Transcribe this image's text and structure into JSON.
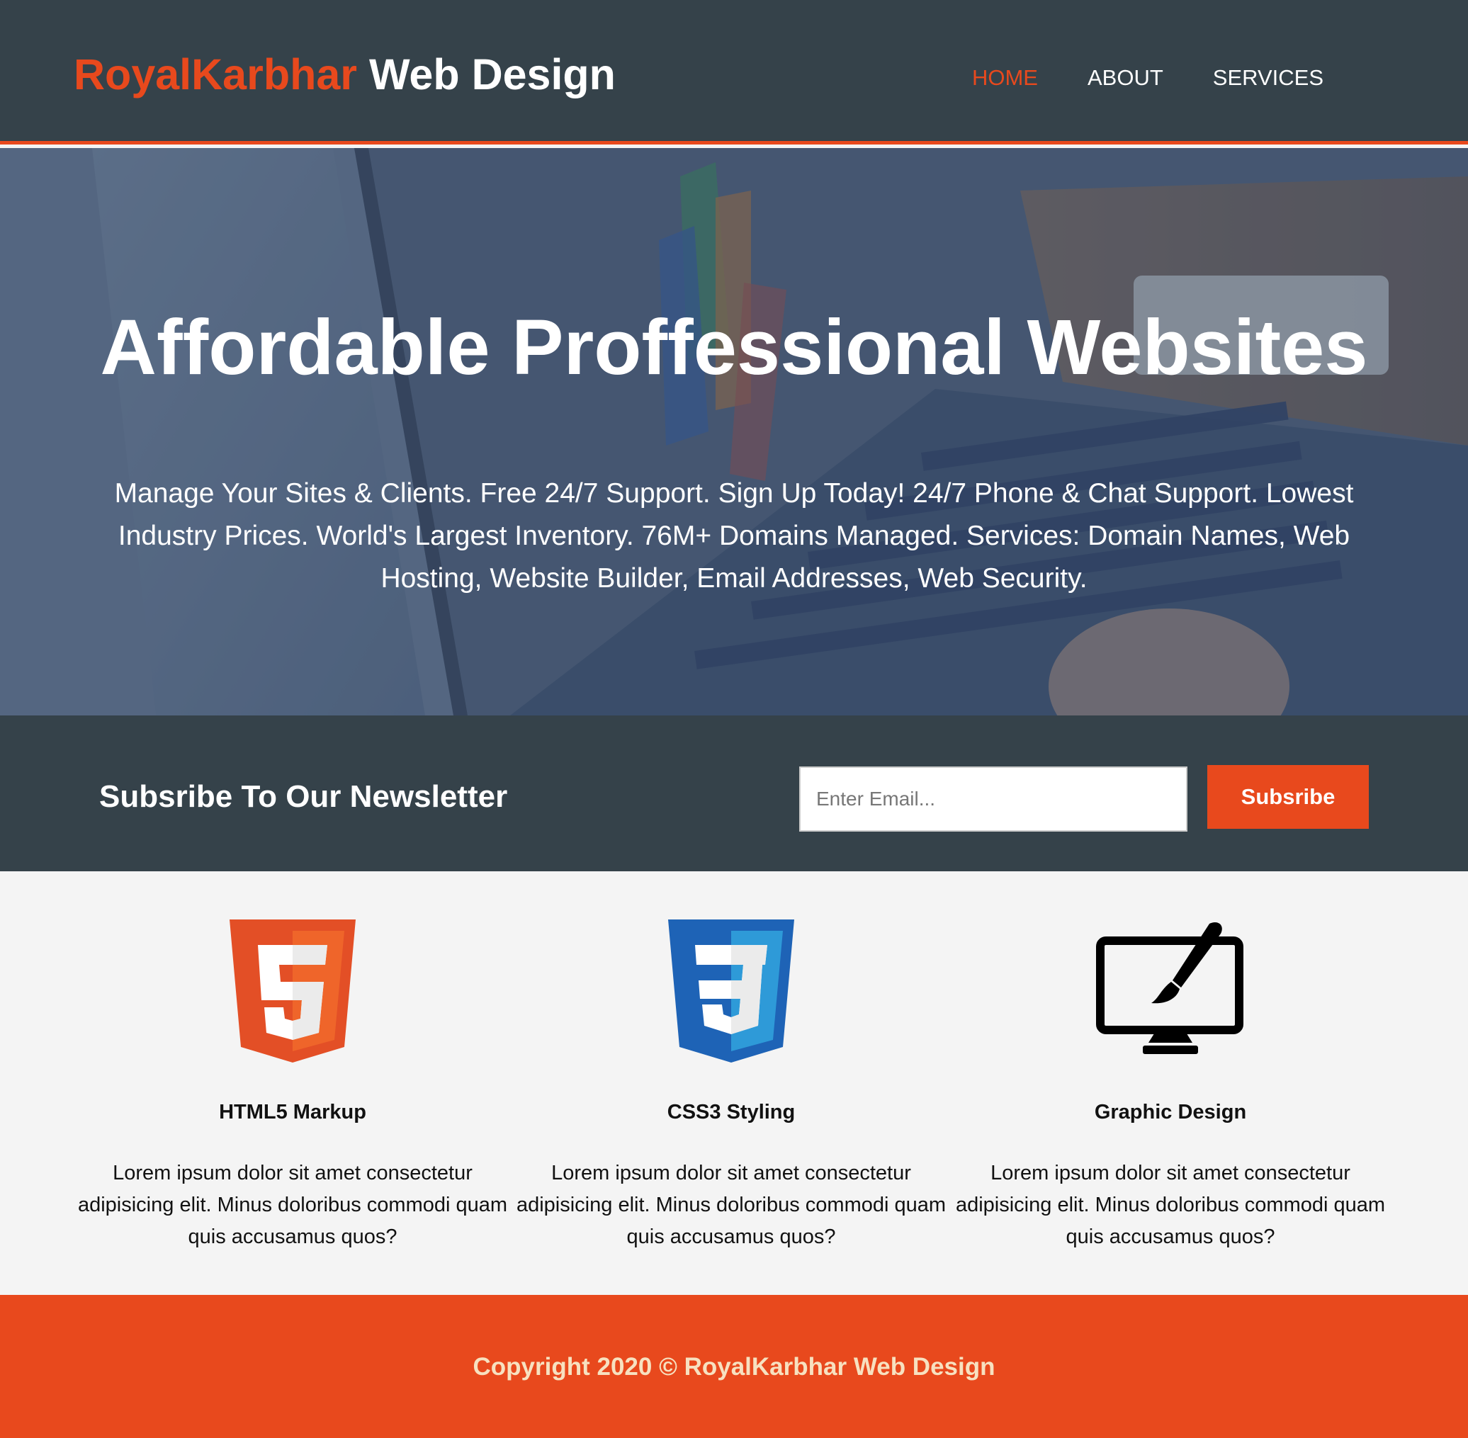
{
  "header": {
    "brand_accent": "RoyalKarbhar",
    "brand_rest": " Web Design",
    "nav": [
      {
        "label": "HOME",
        "active": true
      },
      {
        "label": "ABOUT",
        "active": false
      },
      {
        "label": "SERVICES",
        "active": false
      }
    ]
  },
  "hero": {
    "title": "Affordable Proffessional Websites",
    "text": "Manage Your Sites & Clients. Free 24/7 Support. Sign Up Today! 24/7 Phone & Chat Support. Lowest Industry Prices. World's Largest Inventory. 76M+ Domains Managed. Services: Domain Names, Web Hosting, Website Builder, Email Addresses, Web Security."
  },
  "newsletter": {
    "title": "Subsribe To Our Newsletter",
    "email_placeholder": "Enter Email...",
    "email_value": "",
    "button_label": "Subsribe"
  },
  "features": [
    {
      "icon": "html5-logo-icon",
      "title": "HTML5 Markup",
      "text": "Lorem ipsum dolor sit amet consectetur adipisicing elit. Minus doloribus commodi quam quis accusamus quos?"
    },
    {
      "icon": "css3-logo-icon",
      "title": "CSS3 Styling",
      "text": "Lorem ipsum dolor sit amet consectetur adipisicing elit. Minus doloribus commodi quam quis accusamus quos?"
    },
    {
      "icon": "monitor-paintbrush-icon",
      "title": "Graphic Design",
      "text": "Lorem ipsum dolor sit amet consectetur adipisicing elit. Minus doloribus commodi quam quis accusamus quos?"
    }
  ],
  "footer": {
    "copyright": "Copyright 2020 © RoyalKarbhar Web Design"
  },
  "colors": {
    "header_bg": "#35424a",
    "accent": "#e8491d",
    "page_bg": "#f4f4f4",
    "footer_text": "#f7e1c0"
  }
}
